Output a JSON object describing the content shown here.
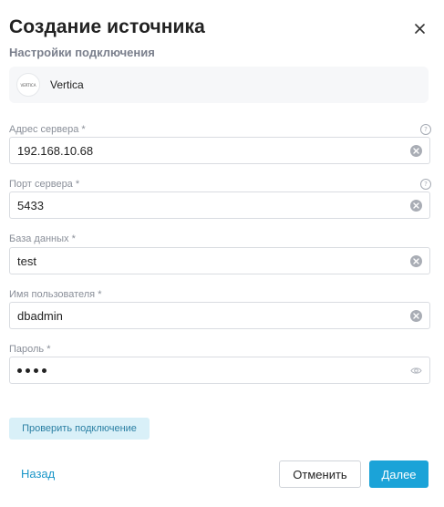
{
  "dialog": {
    "title": "Создание источника",
    "subtitle": "Настройки подключения"
  },
  "source": {
    "logo_text": "VERTICA",
    "name": "Vertica"
  },
  "fields": {
    "server_address": {
      "label": "Адрес сервера",
      "required_mark": "*",
      "value": "192.168.10.68",
      "help": "?"
    },
    "server_port": {
      "label": "Порт сервера",
      "required_mark": "*",
      "value": "5433",
      "help": "?"
    },
    "database": {
      "label": "База данных",
      "required_mark": "*",
      "value": "test"
    },
    "username": {
      "label": "Имя пользователя",
      "required_mark": "*",
      "value": "dbadmin"
    },
    "password": {
      "label": "Пароль",
      "required_mark": "*",
      "masked_length": 4
    }
  },
  "actions": {
    "check_connection": "Проверить подключение",
    "back": "Назад",
    "cancel": "Отменить",
    "next": "Далее"
  },
  "colors": {
    "accent": "#1ba3d8",
    "link": "#1a96c8",
    "check_button_bg": "#d9f0f8",
    "check_button_text": "#2a7fa3"
  },
  "icons": [
    "close-icon",
    "help-icon",
    "clear-icon",
    "eye-icon",
    "vertica-logo"
  ]
}
